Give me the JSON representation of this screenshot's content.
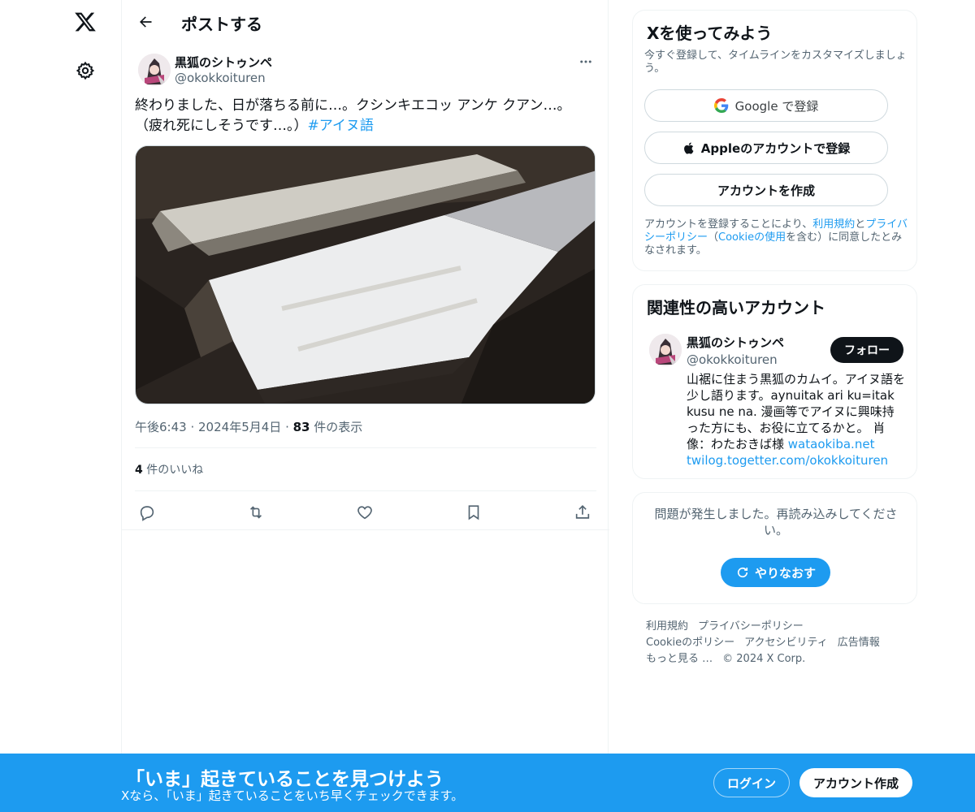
{
  "header": {
    "title": "ポストする"
  },
  "tweet": {
    "author_name": "黒狐のシトゥンペ",
    "author_handle": "@okokkoituren",
    "text_line1": "終わりました、日が落ちる前に…。クシンキエコッ アンケ クアン…。",
    "text_line2_prefix": "（疲れ死にしそうです…。）",
    "hashtag": "#アイヌ語",
    "time": "午後6:43",
    "date": "2024年5月4日",
    "views_count": "83",
    "views_label": "件の表示",
    "likes_count": "4",
    "likes_label": "件のいいね"
  },
  "signup_card": {
    "title": "Xを使ってみよう",
    "subtitle": "今すぐ登録して、タイムラインをカスタマイズしましょう。",
    "google_label": "Google で登録",
    "apple_label": "Appleのアカウントで登録",
    "create_label": "アカウントを作成",
    "legal_prefix": "アカウントを登録することにより、",
    "terms_link": "利用規約",
    "and": "と",
    "privacy_link": "プライバシーポリシー",
    "paren_open": "（",
    "cookie_link": "Cookieの使用",
    "legal_suffix": "を含む）に同意したとみなされます。"
  },
  "related_card": {
    "title": "関連性の高いアカウント",
    "name": "黒狐のシトゥンペ",
    "handle": "@okokkoituren",
    "follow_label": "フォロー",
    "bio": "山裾に住まう黒狐のカムイ。アイヌ語を少し語ります。aynuitak ari ku=itak kusu ne na. 漫画等でアイヌに興味持った方にも、お役に立てるかと。 肖像：わたおきば様 ",
    "link1": "wataokiba.net",
    "link2": "twilog.togetter.com/okokkoituren"
  },
  "error_card": {
    "message": "問題が発生しました。再読み込みしてください。",
    "retry_label": "やりなおす"
  },
  "footer": {
    "links": [
      "利用規約",
      "プライバシーポリシー",
      "Cookieのポリシー",
      "アクセシビリティ",
      "広告情報",
      "もっと見る …",
      "© 2024 X Corp."
    ]
  },
  "banner": {
    "title": "「いま」起きていることを見つけよう",
    "subtitle": "Xなら、「いま」起きていることをいち早くチェックできます。",
    "login_label": "ログイン",
    "signup_label": "アカウント作成"
  },
  "colors": {
    "accent": "#1d9bf0",
    "text": "#0f1419",
    "muted": "#536471"
  },
  "icons": [
    "x-logo-icon",
    "gear-icon",
    "back-arrow-icon",
    "more-icon",
    "reply-icon",
    "retweet-icon",
    "like-icon",
    "bookmark-icon",
    "share-icon",
    "google-icon",
    "apple-icon",
    "refresh-icon"
  ]
}
